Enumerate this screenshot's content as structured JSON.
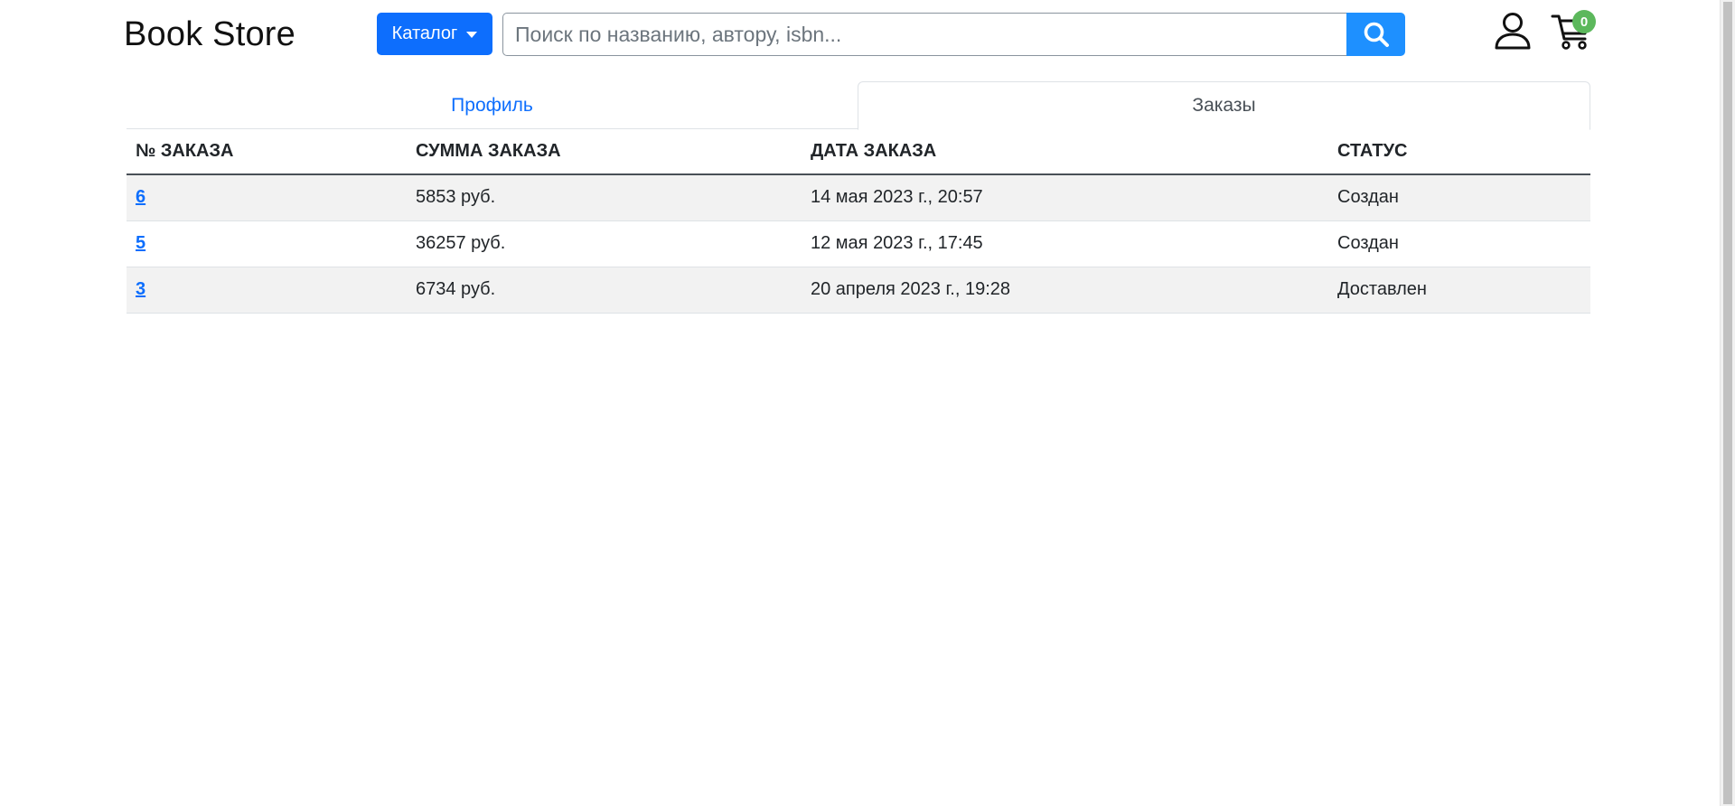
{
  "header": {
    "brand": "Book Store",
    "catalog_label": "Каталог",
    "search_placeholder": "Поиск по названию, автору, isbn...",
    "cart_count": "0"
  },
  "tabs": [
    {
      "label": "Профиль",
      "active": false
    },
    {
      "label": "Заказы",
      "active": true
    }
  ],
  "orders": {
    "columns": [
      "№ ЗАКАЗА",
      "СУММА ЗАКАЗА",
      "ДАТА ЗАКАЗА",
      "СТАТУС"
    ],
    "rows": [
      {
        "id": "6",
        "total": "5853 руб.",
        "date": "14 мая 2023 г., 20:57",
        "status": "Создан"
      },
      {
        "id": "5",
        "total": "36257 руб.",
        "date": "12 мая 2023 г., 17:45",
        "status": "Создан"
      },
      {
        "id": "3",
        "total": "6734 руб.",
        "date": "20 апреля 2023 г., 19:28",
        "status": "Доставлен"
      }
    ]
  },
  "colors": {
    "primary": "#0d6efd",
    "search_button": "#1e90ff",
    "badge": "#5cb85c",
    "row_stripe": "#f2f2f2"
  }
}
